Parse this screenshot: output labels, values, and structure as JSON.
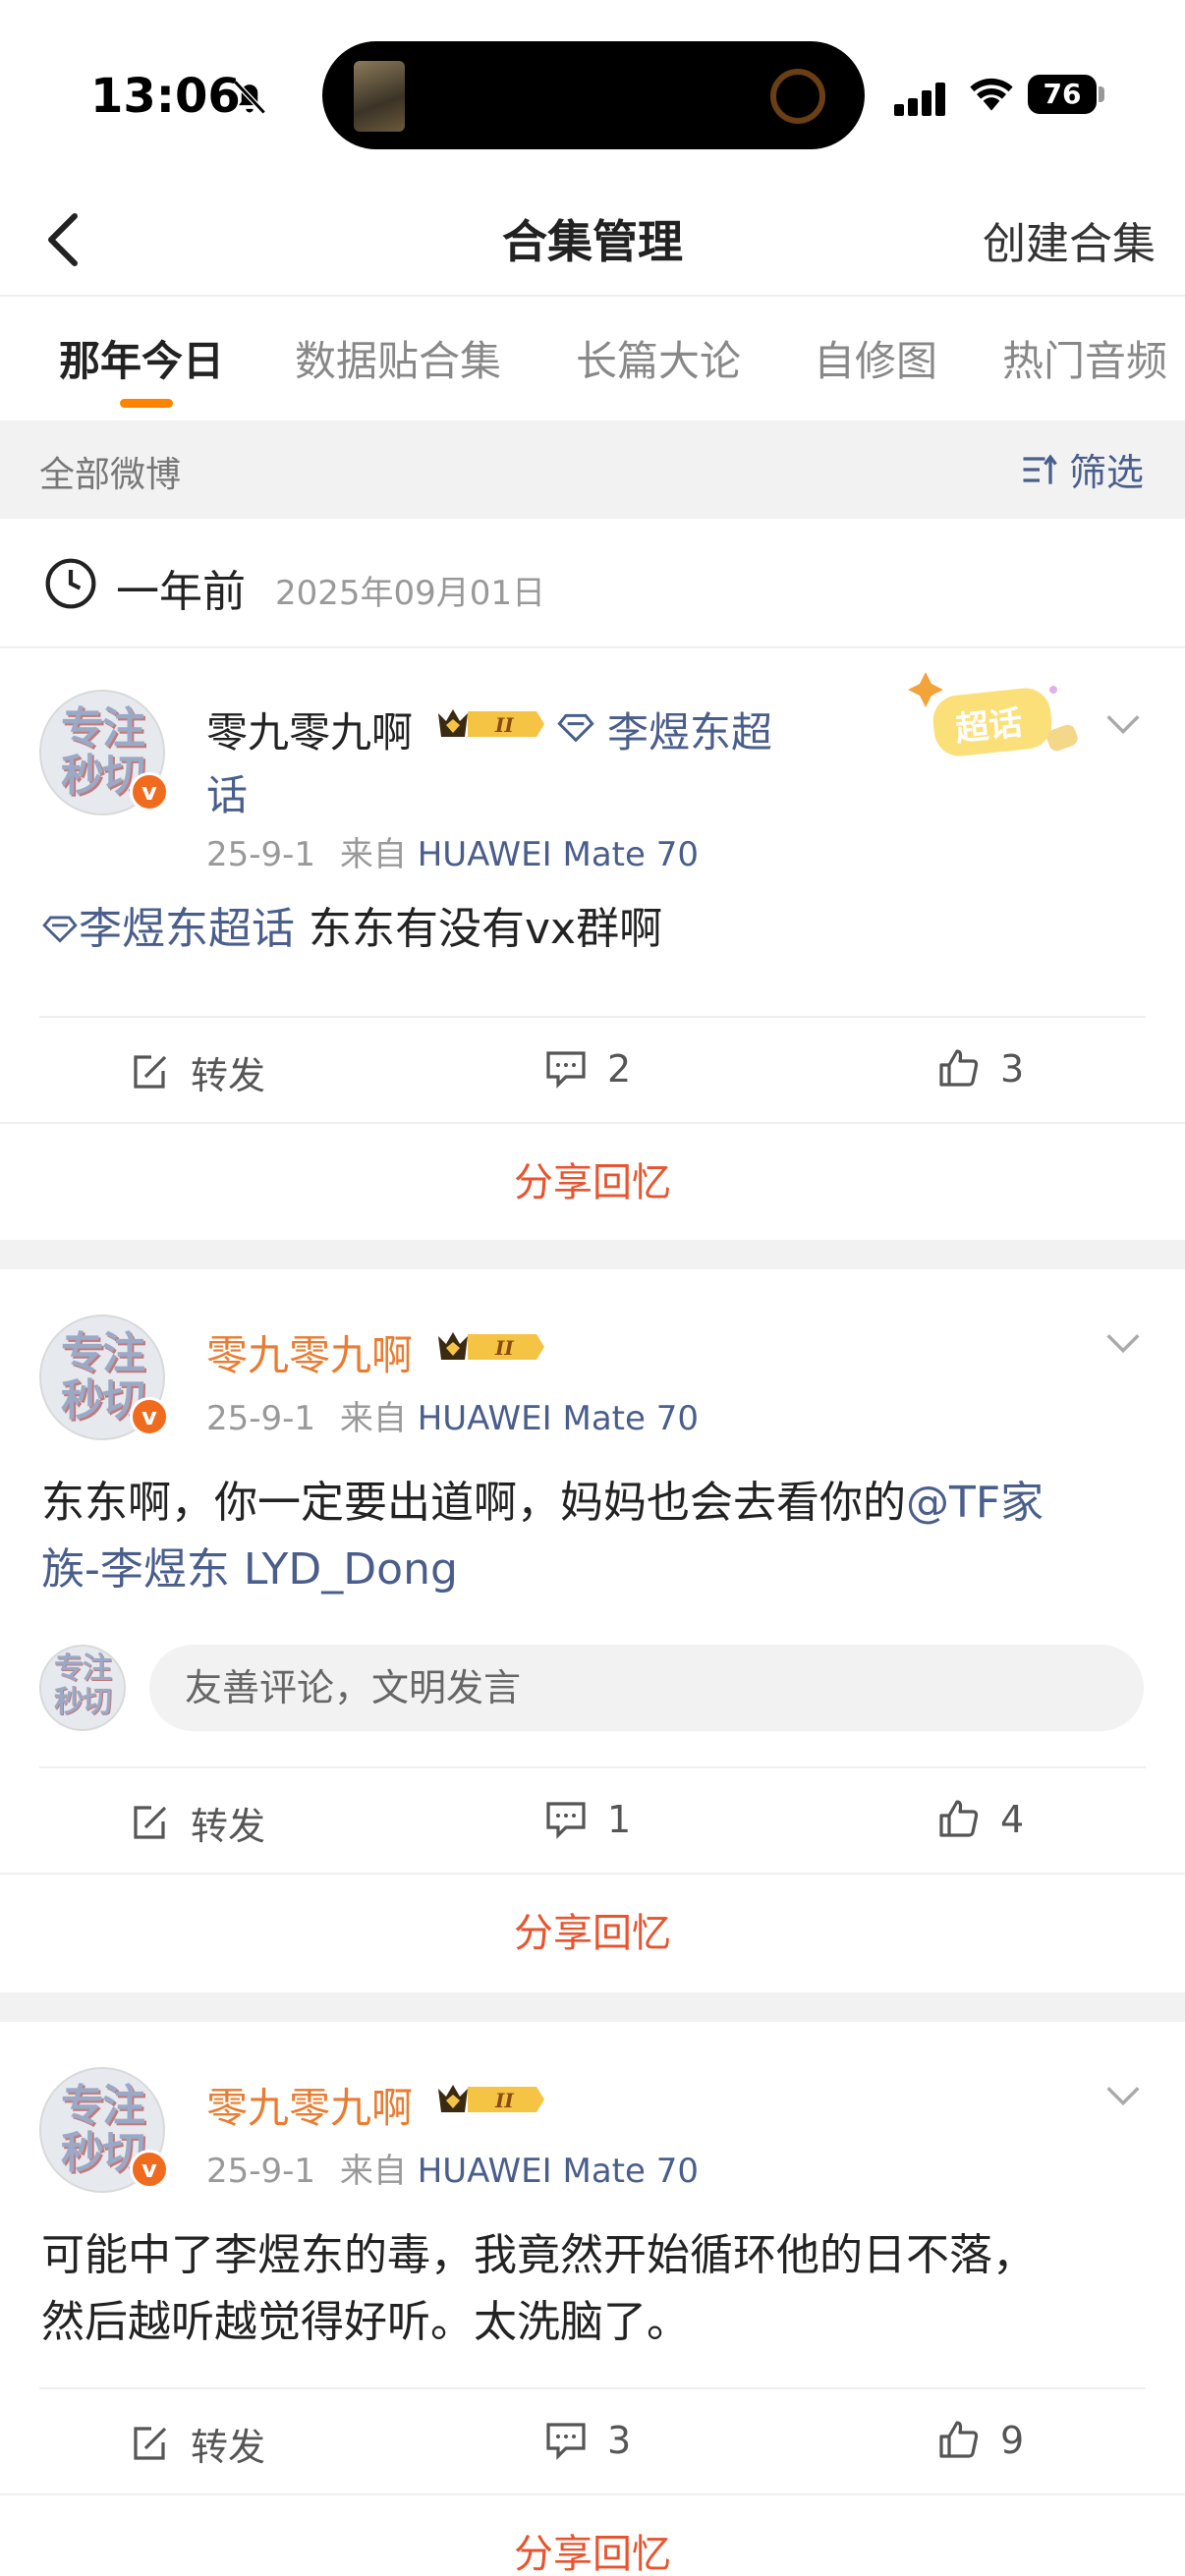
{
  "status_bar": {
    "time": "13:06",
    "battery": "76"
  },
  "nav": {
    "title": "合集管理",
    "action": "创建合集"
  },
  "tabs": [
    "那年今日",
    "数据贴合集",
    "长篇大论",
    "自修图",
    "热门音频"
  ],
  "filter": {
    "label": "全部微博",
    "button": "筛选"
  },
  "date_header": {
    "relative": "一年前",
    "absolute": "2025年09月01日"
  },
  "avatar_text": "专注\n秒切",
  "posts": [
    {
      "username": "零九零九啊",
      "topic_tag": "李煜东超",
      "topic_tag_cont": "话",
      "time": "25-9-1",
      "source_prefix": "来自",
      "device": "HUAWEI Mate 70",
      "topic_link": "李煜东超话",
      "text": " 东东有没有vx群啊",
      "reposts": "转发",
      "comments": "2",
      "likes": "3",
      "share": "分享回忆",
      "supertopic_badge": "超话"
    },
    {
      "username": "零九零九啊",
      "time": "25-9-1",
      "source_prefix": "来自",
      "device": "HUAWEI Mate 70",
      "text": "东东啊，你一定要出道啊，妈妈也会去看你的",
      "mention_line1": "@TF家",
      "mention_line2": "族-李煜东 LYD_Dong",
      "comment_placeholder": "友善评论，文明发言",
      "reposts": "转发",
      "comments": "1",
      "likes": "4",
      "share": "分享回忆"
    },
    {
      "username": "零九零九啊",
      "time": "25-9-1",
      "source_prefix": "来自",
      "device": "HUAWEI Mate 70",
      "text_line1": "可能中了李煜东的毒，我竟然开始循环他的日不落，",
      "text_line2": "然后越听越觉得好听。太洗脑了。",
      "reposts": "转发",
      "comments": "3",
      "likes": "9",
      "share": "分享回忆"
    }
  ],
  "colors": {
    "accent": "#ff8200",
    "link": "#4a5e8c",
    "share": "#e8542e",
    "vip_name": "#ea7b2f"
  },
  "icons": [
    "back-icon",
    "bell-off-icon",
    "signal-icon",
    "wifi-icon",
    "battery-icon",
    "filter-icon",
    "clock-icon",
    "crown-badge-icon",
    "diamond-icon",
    "chevron-down-icon",
    "repost-icon",
    "comment-icon",
    "like-icon"
  ]
}
